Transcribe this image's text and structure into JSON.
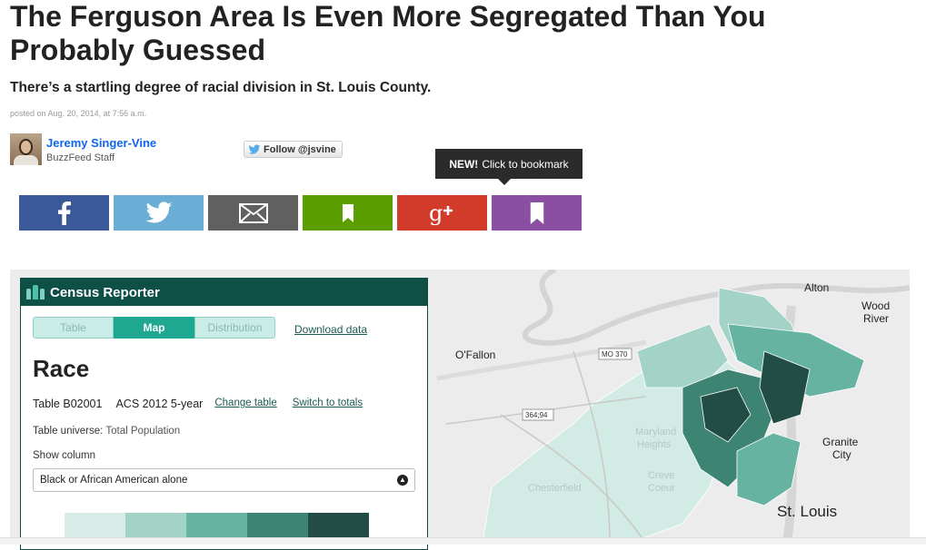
{
  "article": {
    "headline": "The Ferguson Area Is Even More Segregated Than You Probably Guessed",
    "dek": "There’s a startling degree of racial division in St. Louis County.",
    "posted": "posted on Aug. 20, 2014, at 7:56 a.m."
  },
  "author": {
    "name": "Jeremy Singer-Vine",
    "role": "BuzzFeed Staff",
    "follow_label": "Follow @jsvine"
  },
  "tooltip": {
    "badge": "NEW!",
    "text": "Click to bookmark"
  },
  "share_buttons": [
    {
      "network": "facebook",
      "icon": "facebook-icon",
      "color": "#3b5998"
    },
    {
      "network": "twitter",
      "icon": "twitter-bird-icon",
      "color": "#6aaed6"
    },
    {
      "network": "email",
      "icon": "envelope-icon",
      "color": "#606060"
    },
    {
      "network": "bookmark",
      "icon": "bookmark-icon",
      "color": "#5a9e00"
    },
    {
      "network": "google-plus",
      "icon": "google-plus-icon",
      "color": "#d23b2a"
    },
    {
      "network": "bookmark-new",
      "icon": "bookmark-icon",
      "color": "#8a4ea3"
    }
  ],
  "census": {
    "brand": "Census Reporter",
    "tabs": [
      "Table",
      "Map",
      "Distribution"
    ],
    "active_tab": "Map",
    "download_label": "Download data",
    "title": "Race",
    "table_id": "Table B02001",
    "dataset": "ACS 2012 5-year",
    "change_table": "Change table",
    "switch_totals": "Switch to totals",
    "universe_label": "Table universe:",
    "universe_value": "Total Population",
    "show_column_label": "Show column",
    "selected_column": "Black or African American alone",
    "legend_colors": [
      "#d9ede8",
      "#a3d2c7",
      "#67b3a1",
      "#3e8473",
      "#214d44"
    ]
  },
  "map": {
    "labels": {
      "alton": "Alton",
      "wood_river_1": "Wood",
      "wood_river_2": "River",
      "ofallon": "O'Fallon",
      "mo370": "MO 370",
      "rt364": "364;94",
      "granite_1": "Granite",
      "granite_2": "City",
      "stlouis": "St. Louis",
      "chesterfield": "Chesterfield",
      "maryland_1": "Maryland",
      "maryland_2": "Heights",
      "creve_1": "Creve",
      "creve_2": "Coeur"
    }
  }
}
